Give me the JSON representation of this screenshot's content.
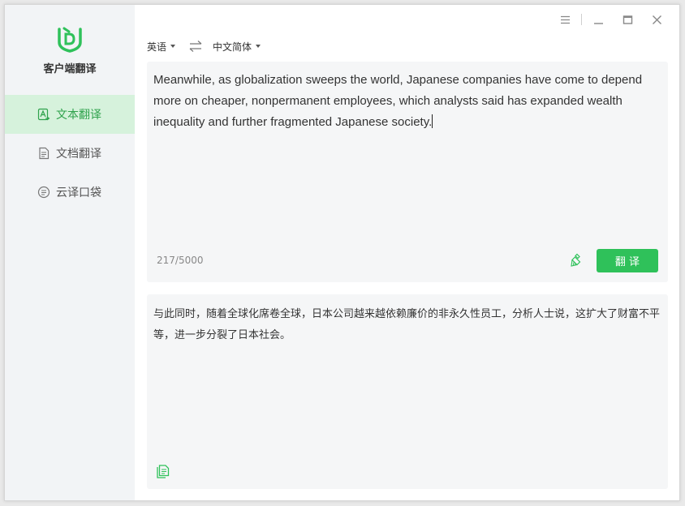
{
  "app": {
    "name": "客户端翻译"
  },
  "sidebar": {
    "items": [
      {
        "label": "文本翻译",
        "icon": "text-translate-icon",
        "active": true
      },
      {
        "label": "文档翻译",
        "icon": "document-icon",
        "active": false
      },
      {
        "label": "云译口袋",
        "icon": "cloud-pocket-icon",
        "active": false
      }
    ]
  },
  "lang": {
    "source": "英语",
    "target": "中文简体"
  },
  "source": {
    "text": "Meanwhile, as globalization sweeps the world, Japanese companies have come to depend more on cheaper, nonpermanent employees, which analysts said has expanded wealth inequality and further fragmented Japanese society.",
    "count": "217/5000"
  },
  "translate_button": "翻 译",
  "result": {
    "text": "与此同时，随着全球化席卷全球，日本公司越来越依赖廉价的非永久性员工，分析人士说，这扩大了财富不平等，进一步分裂了日本社会。"
  },
  "colors": {
    "accent": "#2fc15a",
    "active_bg": "#d6f2dc",
    "active_text": "#2fa24c"
  }
}
